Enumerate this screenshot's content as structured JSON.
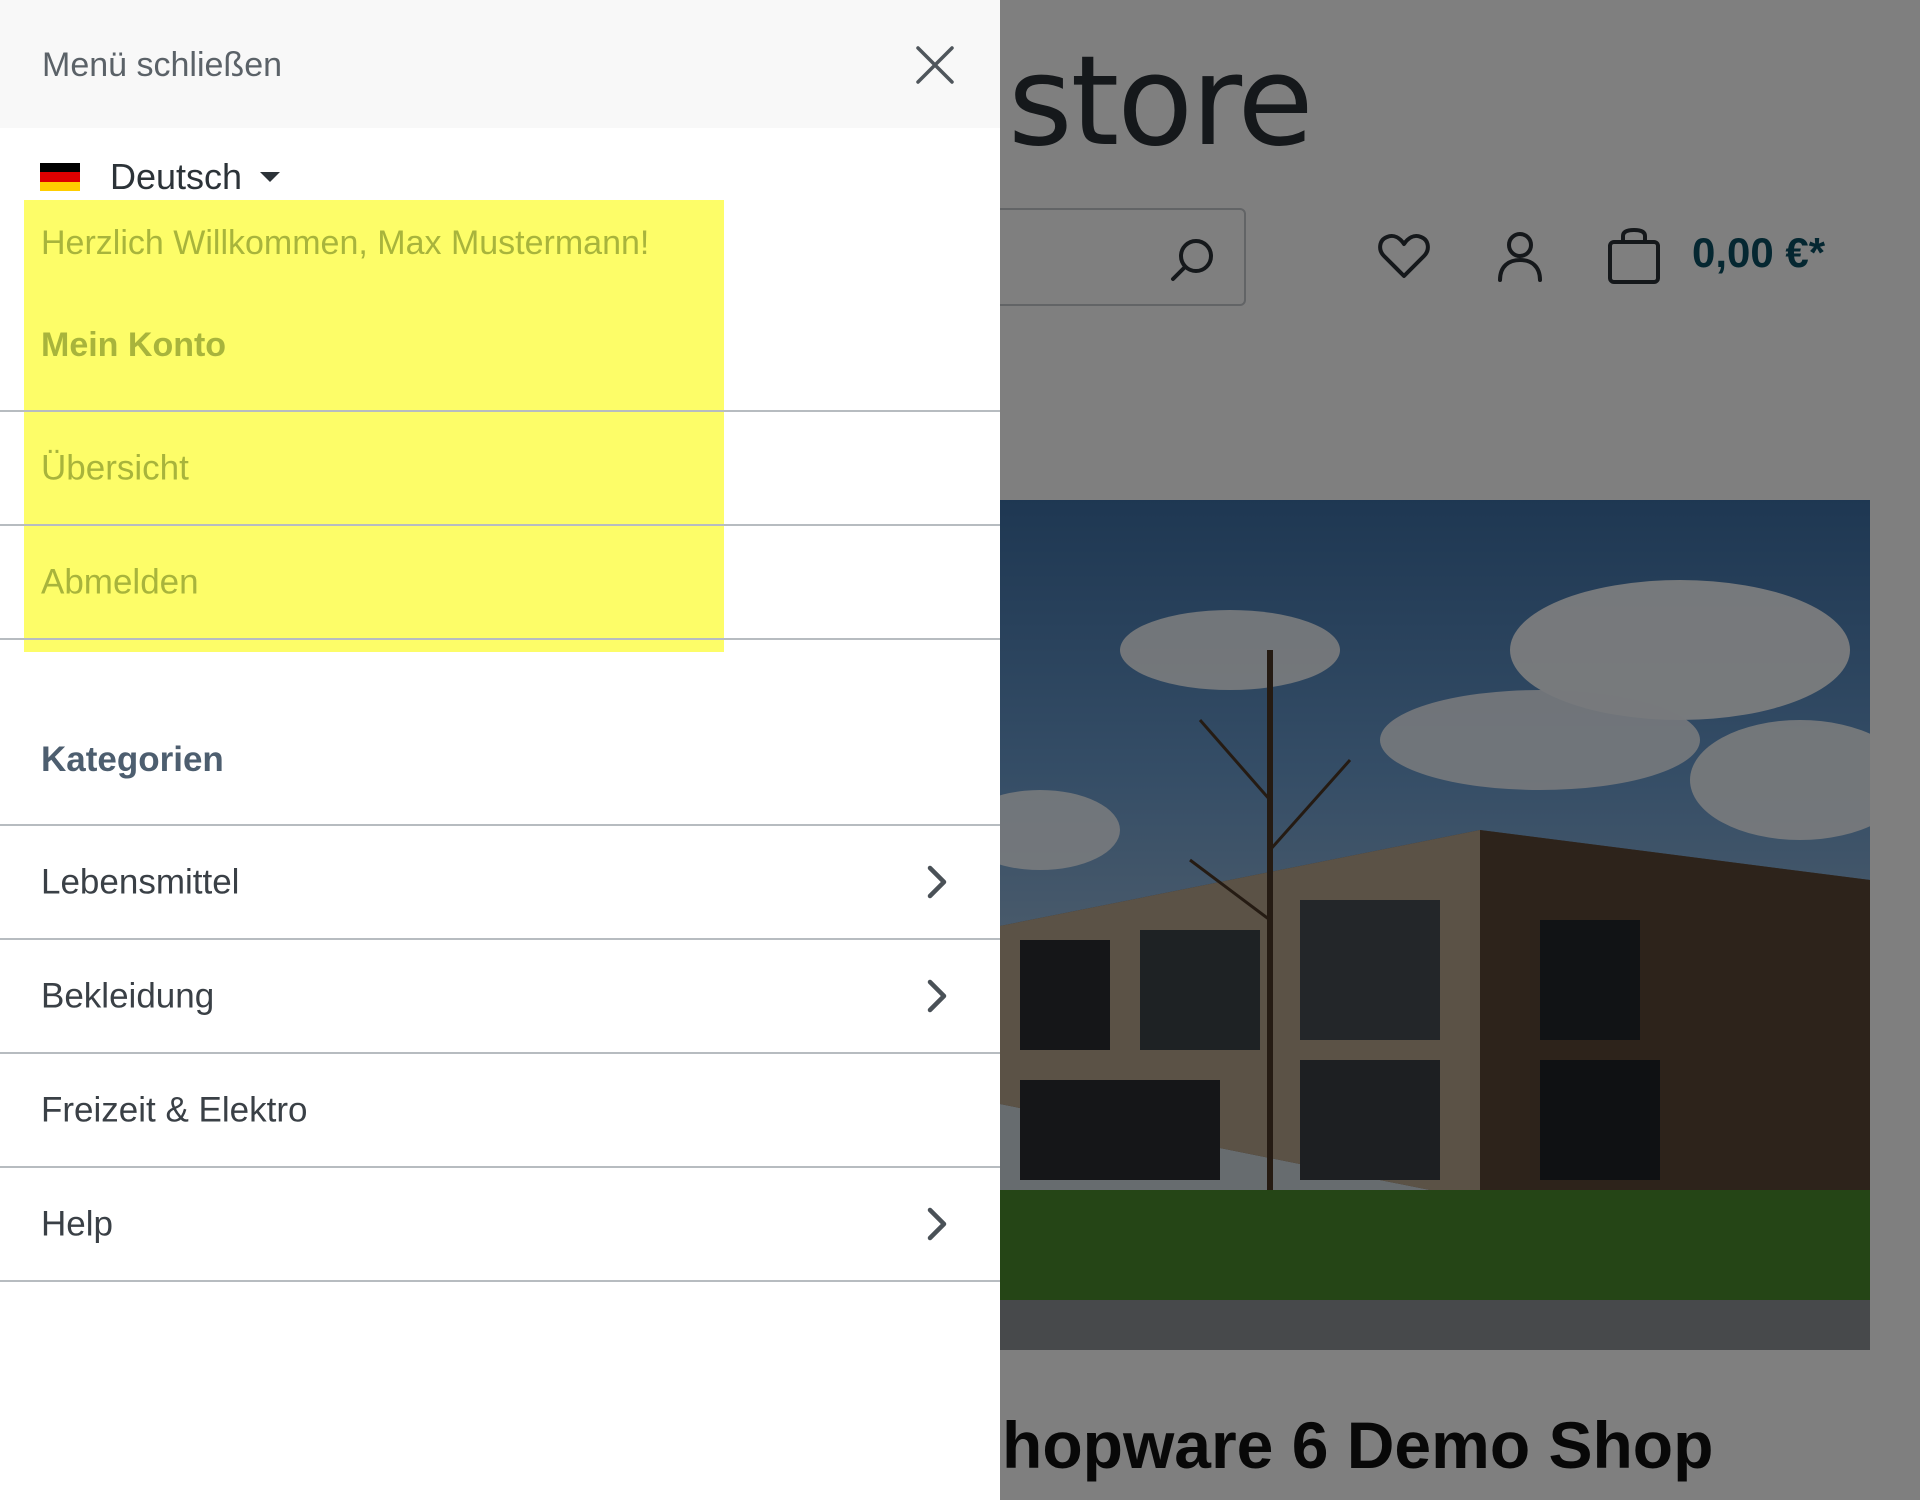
{
  "shop": {
    "logo_text": "store",
    "cart_price": "0,00 €*",
    "heading": "hopware 6 Demo Shop",
    "accent_color": "#0b4f63",
    "icons": [
      "search-icon",
      "heart-icon",
      "user-icon",
      "bag-icon"
    ]
  },
  "offcanvas": {
    "close_label": "Menü schließen",
    "close_icon": "close-icon",
    "language": {
      "label": "Deutsch",
      "flag": "flag-de-icon"
    },
    "greeting": "Herzlich Willkommen, Max Mustermann!",
    "account_title": "Mein Konto",
    "account_items": [
      {
        "label": "Übersicht"
      },
      {
        "label": "Abmelden"
      }
    ],
    "categories_title": "Kategorien",
    "categories": [
      {
        "label": "Lebensmittel",
        "has_children": true
      },
      {
        "label": "Bekleidung",
        "has_children": true
      },
      {
        "label": "Freizeit & Elektro",
        "has_children": false
      },
      {
        "label": "Help",
        "has_children": true
      }
    ],
    "highlight_color": "#fdfd68"
  }
}
